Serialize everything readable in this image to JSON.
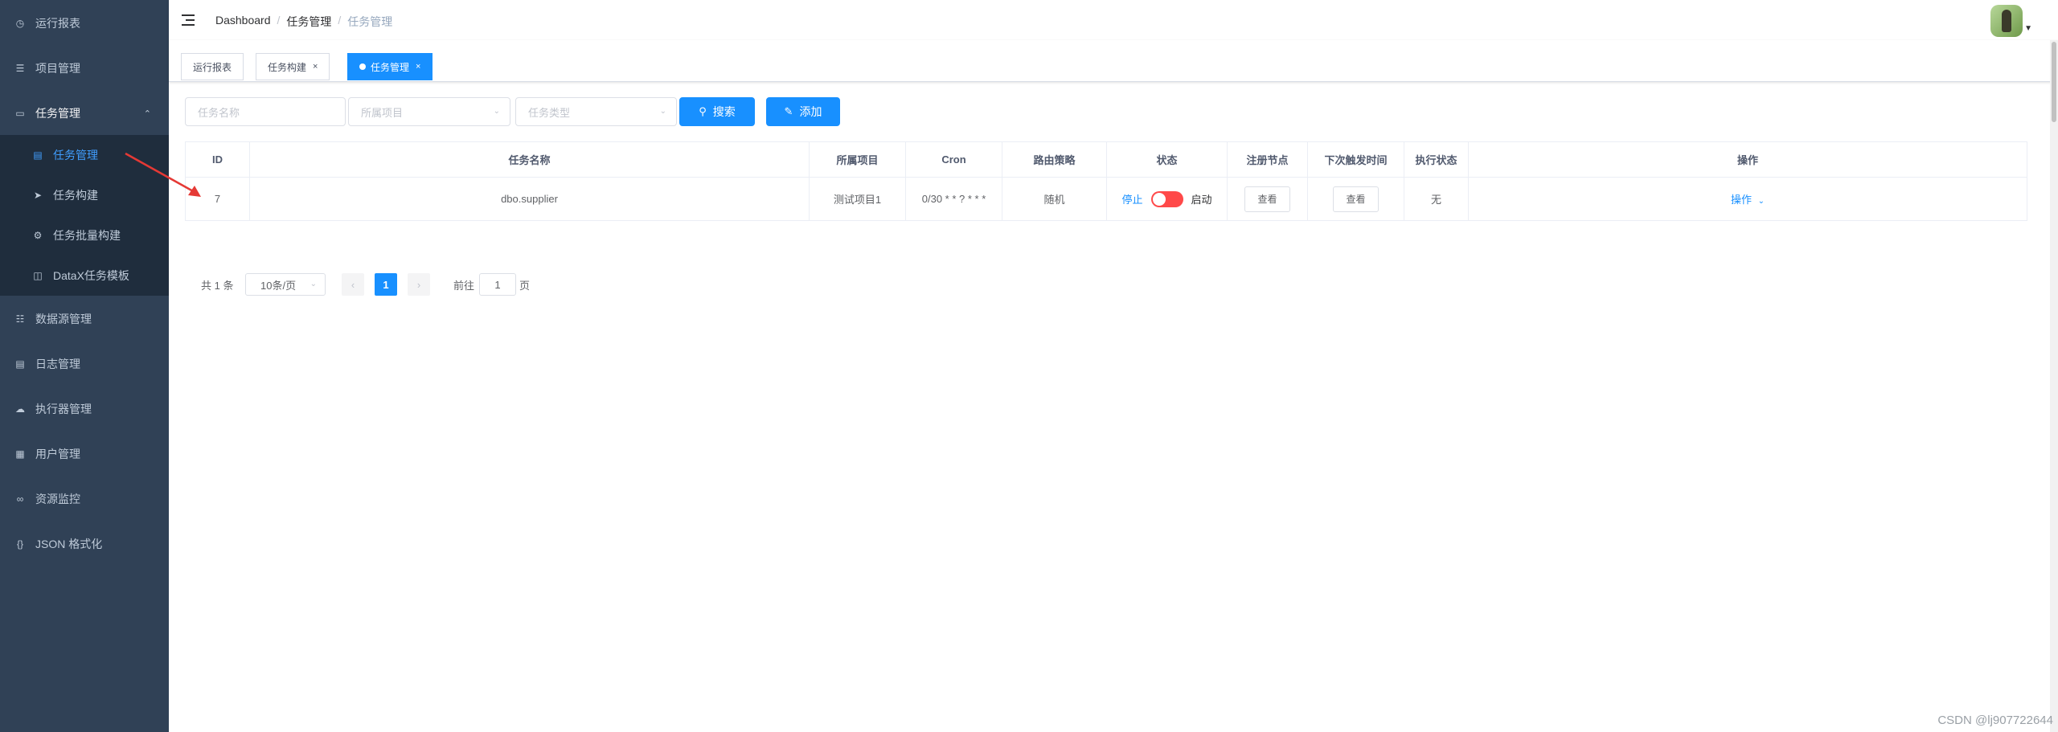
{
  "sidebar": {
    "items": [
      {
        "label": "运行报表",
        "icon": "dashboard-icon"
      },
      {
        "label": "项目管理",
        "icon": "database-icon"
      },
      {
        "label": "任务管理",
        "icon": "monitor-icon",
        "expanded": true
      },
      {
        "label": "数据源管理",
        "icon": "datasource-icon"
      },
      {
        "label": "日志管理",
        "icon": "log-icon"
      },
      {
        "label": "执行器管理",
        "icon": "executor-icon"
      },
      {
        "label": "用户管理",
        "icon": "user-grid-icon"
      },
      {
        "label": "资源监控",
        "icon": "monitor-link-icon"
      },
      {
        "label": "JSON 格式化",
        "icon": "json-icon"
      }
    ],
    "submenu": [
      {
        "label": "任务管理",
        "icon": "task-list-icon",
        "active": true
      },
      {
        "label": "任务构建",
        "icon": "send-icon"
      },
      {
        "label": "任务批量构建",
        "icon": "batch-icon"
      },
      {
        "label": "DataX任务模板",
        "icon": "template-icon"
      }
    ]
  },
  "navbar": {
    "breadcrumb": [
      "Dashboard",
      "任务管理",
      "任务管理"
    ]
  },
  "tags": [
    {
      "label": "运行报表"
    },
    {
      "label": "任务构建",
      "close": "×"
    },
    {
      "label": "任务管理",
      "close": "×",
      "active": true
    }
  ],
  "filter": {
    "task_name_placeholder": "任务名称",
    "project_placeholder": "所属项目",
    "task_type_placeholder": "任务类型",
    "search_label": "搜索",
    "add_label": "添加"
  },
  "table": {
    "headers": [
      "ID",
      "任务名称",
      "所属项目",
      "Cron",
      "路由策略",
      "状态",
      "注册节点",
      "下次触发时间",
      "执行状态",
      "操作"
    ],
    "rows": [
      {
        "id": "7",
        "name": "dbo.supplier",
        "project": "测试项目1",
        "cron": "0/30 * * ? * * *",
        "route": "随机",
        "status_off": "停止",
        "status_on": "启动",
        "switch_on": false,
        "register_node": "查看",
        "next_trigger": "查看",
        "exec_status": "无",
        "action": "操作"
      }
    ]
  },
  "pagination": {
    "total": "共 1 条",
    "page_size": "10条/页",
    "current_page": "1",
    "goto_label": "前往",
    "goto_value": "1",
    "page_suffix": "页"
  },
  "watermark": "CSDN @lj907722644",
  "colors": {
    "sidebar_bg": "#304156",
    "submenu_bg": "#1f2d3d",
    "primary": "#1890ff",
    "switch_off": "#ff4949",
    "annotation_arrow": "#e53935"
  }
}
